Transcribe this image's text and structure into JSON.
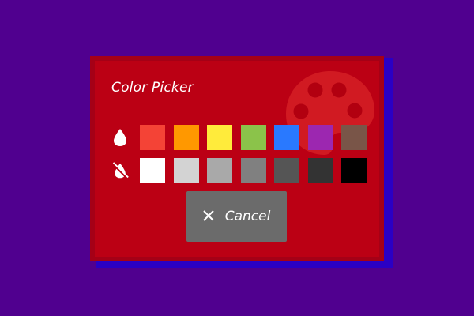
{
  "dialog": {
    "title": "Color Picker",
    "background_icon": "palette-icon",
    "colors": {
      "page_background": "#50008f",
      "dialog_background": "#bb0014",
      "dialog_shadow": "#2a00c4",
      "button_background": "#6b6b6b"
    }
  },
  "swatches": {
    "row_1_icon": "droplet-icon",
    "row_2_icon": "droplet-off-icon",
    "colored": [
      "#f44336",
      "#ff9800",
      "#ffeb3b",
      "#8bc34a",
      "#2979ff",
      "#9c27b0",
      "#795548"
    ],
    "grays": [
      "#ffffff",
      "#d3d3d3",
      "#a9a9a9",
      "#808080",
      "#555555",
      "#333333",
      "#000000"
    ]
  },
  "cancel_button": {
    "label": "Cancel",
    "icon": "close-icon"
  }
}
